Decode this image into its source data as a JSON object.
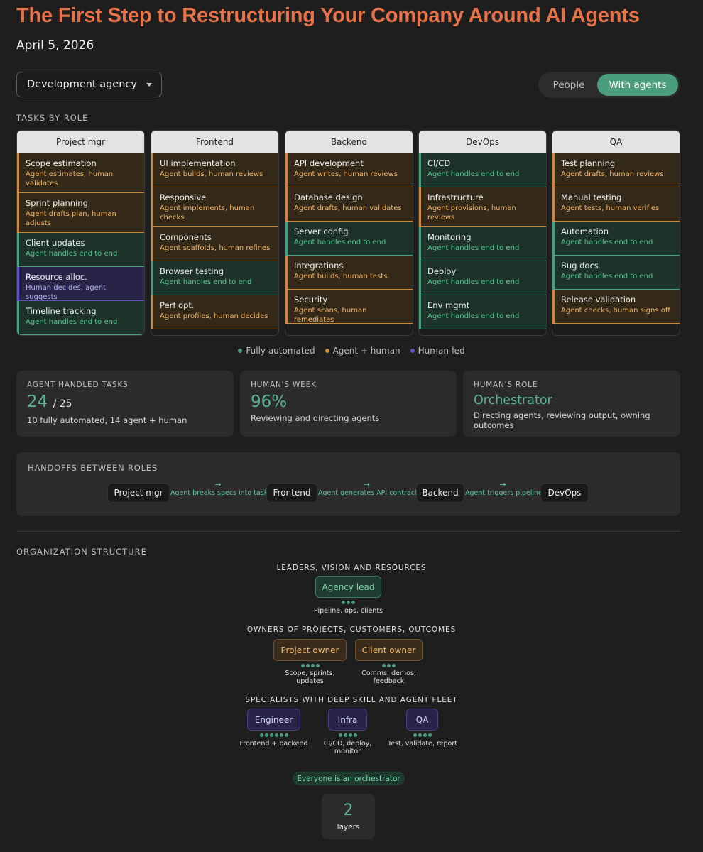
{
  "header": {
    "title": "The First Step to Restructuring Your Company Around AI Agents",
    "date": "April 5, 2026"
  },
  "controls": {
    "dropdown_value": "Development agency",
    "toggle": {
      "off_label": "People",
      "on_label": "With agents"
    }
  },
  "tasks_section": {
    "label": "TASKS BY ROLE"
  },
  "roles": [
    {
      "name": "Project mgr",
      "tasks": [
        {
          "name": "Scope estimation",
          "desc": "Agent estimates, human validates",
          "kind": "mixed"
        },
        {
          "name": "Sprint planning",
          "desc": "Agent drafts plan, human adjusts",
          "kind": "mixed"
        },
        {
          "name": "Client updates",
          "desc": "Agent handles end to end",
          "kind": "auto"
        },
        {
          "name": "Resource alloc.",
          "desc": "Human decides, agent suggests",
          "kind": "human"
        },
        {
          "name": "Timeline tracking",
          "desc": "Agent handles end to end",
          "kind": "auto"
        }
      ]
    },
    {
      "name": "Frontend",
      "tasks": [
        {
          "name": "UI implementation",
          "desc": "Agent builds, human reviews",
          "kind": "mixed"
        },
        {
          "name": "Responsive",
          "desc": "Agent implements, human checks",
          "kind": "mixed"
        },
        {
          "name": "Components",
          "desc": "Agent scaffolds, human refines",
          "kind": "mixed"
        },
        {
          "name": "Browser testing",
          "desc": "Agent handles end to end",
          "kind": "auto"
        },
        {
          "name": "Perf opt.",
          "desc": "Agent profiles, human decides",
          "kind": "mixed"
        }
      ]
    },
    {
      "name": "Backend",
      "tasks": [
        {
          "name": "API development",
          "desc": "Agent writes, human reviews",
          "kind": "mixed"
        },
        {
          "name": "Database design",
          "desc": "Agent drafts, human validates",
          "kind": "mixed"
        },
        {
          "name": "Server config",
          "desc": "Agent handles end to end",
          "kind": "auto"
        },
        {
          "name": "Integrations",
          "desc": "Agent builds, human tests",
          "kind": "mixed"
        },
        {
          "name": "Security",
          "desc": "Agent scans, human remediates",
          "kind": "mixed"
        }
      ]
    },
    {
      "name": "DevOps",
      "tasks": [
        {
          "name": "CI/CD",
          "desc": "Agent handles end to end",
          "kind": "auto"
        },
        {
          "name": "Infrastructure",
          "desc": "Agent provisions, human reviews",
          "kind": "mixed"
        },
        {
          "name": "Monitoring",
          "desc": "Agent handles end to end",
          "kind": "auto"
        },
        {
          "name": "Deploy",
          "desc": "Agent handles end to end",
          "kind": "auto"
        },
        {
          "name": "Env mgmt",
          "desc": "Agent handles end to end",
          "kind": "auto"
        }
      ]
    },
    {
      "name": "QA",
      "tasks": [
        {
          "name": "Test planning",
          "desc": "Agent drafts, human reviews",
          "kind": "mixed"
        },
        {
          "name": "Manual testing",
          "desc": "Agent tests, human verifies",
          "kind": "mixed"
        },
        {
          "name": "Automation",
          "desc": "Agent handles end to end",
          "kind": "auto"
        },
        {
          "name": "Bug docs",
          "desc": "Agent handles end to end",
          "kind": "auto"
        },
        {
          "name": "Release validation",
          "desc": "Agent checks, human signs off",
          "kind": "mixed"
        }
      ]
    }
  ],
  "legend": [
    {
      "label": "Fully automated",
      "color": "#4a9e7d"
    },
    {
      "label": "Agent + human",
      "color": "#c98a3c"
    },
    {
      "label": "Human-led",
      "color": "#5b54c2"
    }
  ],
  "stats": {
    "agent_tasks": {
      "label": "AGENT HANDLED TASKS",
      "value": "24",
      "total": "/ 25",
      "desc": "10 fully automated, 14 agent + human"
    },
    "humans_week": {
      "label": "HUMAN'S WEEK",
      "value": "96%",
      "desc": "Reviewing and directing agents"
    },
    "humans_role": {
      "label": "HUMAN'S ROLE",
      "value": "Orchestrator",
      "desc": "Directing agents, reviewing output, owning outcomes"
    }
  },
  "handoffs": {
    "label": "HANDOFFS BETWEEN ROLES",
    "nodes": [
      "Project mgr",
      "Frontend",
      "Backend",
      "DevOps"
    ],
    "arrows": [
      {
        "symbol": "→",
        "text": "Agent breaks specs into tasks"
      },
      {
        "symbol": "→",
        "text": "Agent generates API contracts"
      },
      {
        "symbol": "→",
        "text": "Agent triggers pipeline"
      }
    ]
  },
  "org": {
    "label": "ORGANIZATION STRUCTURE",
    "tiers": [
      {
        "label": "LEADERS, VISION AND RESOURCES"
      },
      {
        "label": "OWNERS OF PROJECTS, CUSTOMERS, OUTCOMES"
      },
      {
        "label": "SPECIALISTS WITH DEEP SKILL AND AGENT FLEET"
      }
    ],
    "leader": {
      "name": "Agency lead",
      "caption": "Pipeline, ops, clients",
      "agents": 3
    },
    "owners": [
      {
        "name": "Project owner",
        "caption": "Scope, sprints, updates",
        "agents": 4
      },
      {
        "name": "Client owner",
        "caption": "Comms, demos, feedback",
        "agents": 3
      }
    ],
    "specialists": [
      {
        "name": "Engineer",
        "caption": "Frontend + backend",
        "agents": 6
      },
      {
        "name": "Infra",
        "caption": "CI/CD, deploy, monitor",
        "agents": 4
      },
      {
        "name": "QA",
        "caption": "Test, validate, report",
        "agents": 4
      }
    ],
    "pill": "Everyone is an orchestrator",
    "layers": {
      "value": "2",
      "label": "layers"
    }
  }
}
